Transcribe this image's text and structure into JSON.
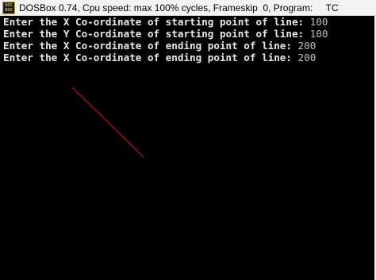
{
  "window": {
    "title": "DOSBox 0.74, Cpu speed: max 100% cycles, Frameskip  0, Program:     TC",
    "icon_label": "DOS BOX",
    "icon_name": "dosbox-app-icon"
  },
  "console": {
    "lines": [
      {
        "prompt": "Enter the X Co-ordinate of starting point of line: ",
        "value": "100"
      },
      {
        "prompt": "Enter the Y Co-ordinate of starting point of line: ",
        "value": "100"
      },
      {
        "prompt": "Enter the X Co-ordinate of ending point of line: ",
        "value": "200"
      },
      {
        "prompt": "Enter the X Co-ordinate of ending point of line: ",
        "value": "200"
      }
    ]
  },
  "graphics": {
    "line_color": "#b01818",
    "background": "#000000"
  }
}
